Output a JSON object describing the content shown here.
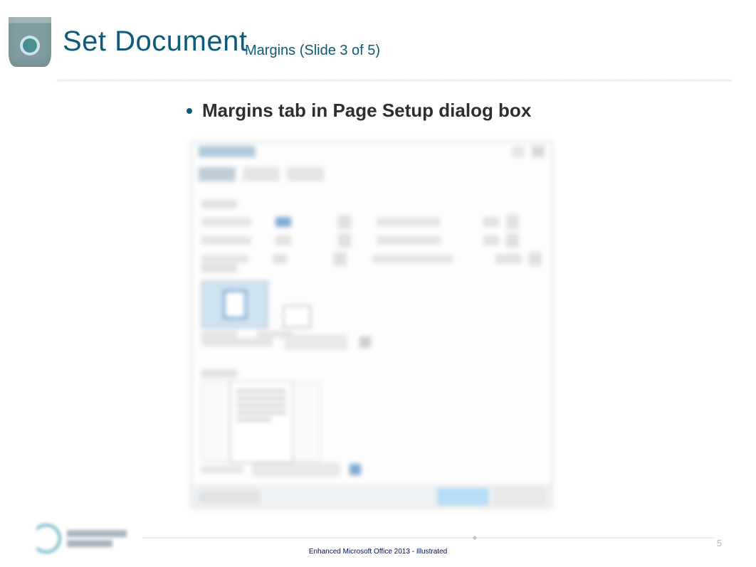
{
  "header": {
    "title": "Set Document",
    "subtitle": "Margins (Slide 3 of 5)"
  },
  "bullet": "Margins tab in Page Setup dialog box",
  "dialog": {
    "title": "Page Setup",
    "tabs": [
      "Margins",
      "Paper",
      "Layout"
    ],
    "active_tab": "Margins",
    "margins": {
      "top": "1\"",
      "bottom": "1\"",
      "left": "1\"",
      "right": "1\"",
      "gutter": "0\"",
      "gutter_position": "Left"
    },
    "orientation": {
      "options": [
        "Portrait",
        "Landscape"
      ],
      "selected": "Portrait"
    },
    "multiple_pages": "Normal",
    "apply_to": "Whole document",
    "buttons": {
      "default": "Set As Default",
      "ok": "OK",
      "cancel": "Cancel"
    }
  },
  "footer": {
    "caption": "Enhanced Microsoft Office 2013 - Illustrated",
    "page_number": "5"
  }
}
